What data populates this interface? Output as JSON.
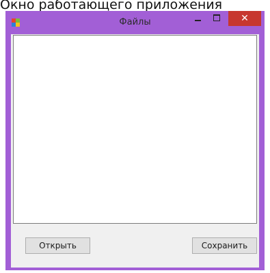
{
  "caption": "Окно работающего приложения",
  "window": {
    "title": "Файлы",
    "close_glyph": "✕"
  },
  "buttons": {
    "open_label": "Открыть",
    "save_label": "Сохранить"
  },
  "colors": {
    "frame": "#a25fd6",
    "close": "#c7372f",
    "client": "#f0f0f0"
  },
  "icons": [
    "app-icon",
    "minimize-icon",
    "maximize-icon",
    "close-icon"
  ]
}
